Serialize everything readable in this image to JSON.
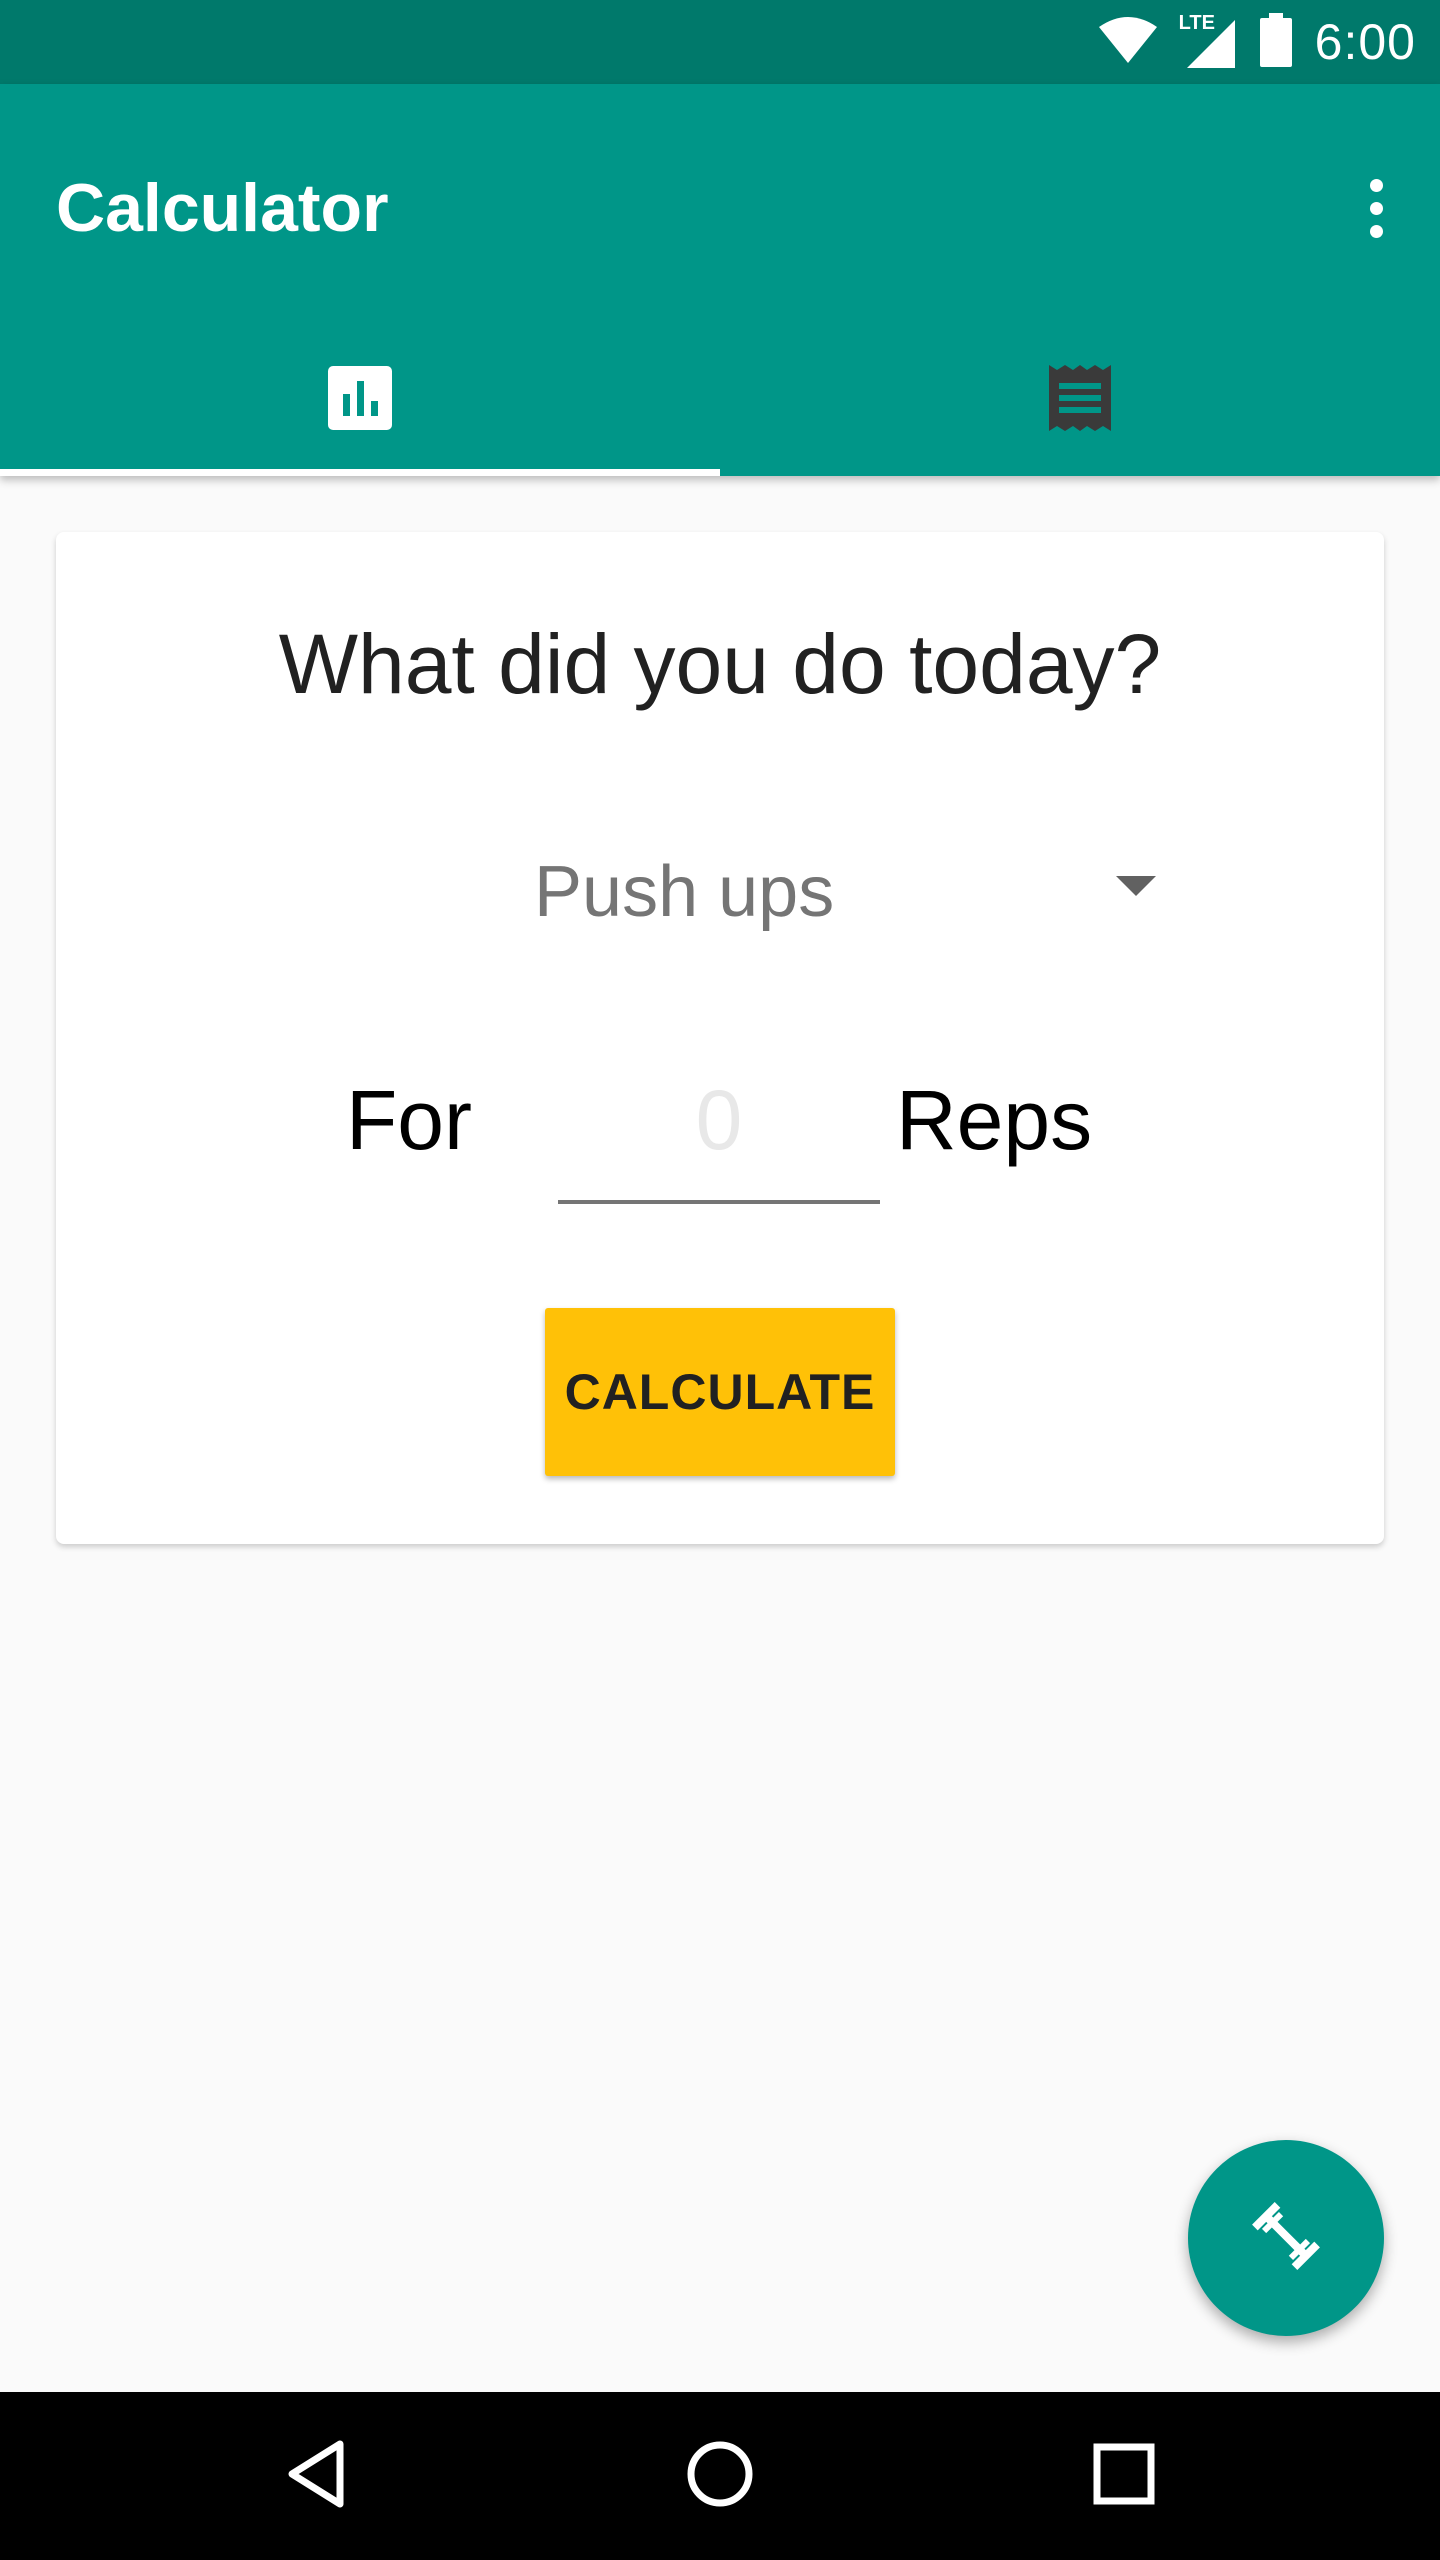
{
  "status_bar": {
    "time": "6:00",
    "network": "LTE",
    "icons": [
      "wifi-icon",
      "cell-signal-icon",
      "battery-icon"
    ]
  },
  "app_bar": {
    "title": "Calculator",
    "overflow_icon": "more-vert-icon"
  },
  "tabs": [
    {
      "icon": "bar-chart-icon",
      "active": true
    },
    {
      "icon": "receipt-list-icon",
      "active": false
    }
  ],
  "card": {
    "question": "What did you do today?",
    "exercise_select": {
      "value": "Push ups"
    },
    "for_label": "For",
    "reps_input": {
      "placeholder": "0"
    },
    "reps_label": "Reps",
    "calculate_button": "CALCULATE"
  },
  "fab": {
    "icon": "fitness-dumbbell-icon"
  },
  "nav_bar": {
    "buttons": [
      "back-icon",
      "home-icon",
      "recents-icon"
    ]
  },
  "colors": {
    "primary": "#009688",
    "primary_dark": "#00796b",
    "accent": "#ffc107",
    "background": "#fafafa"
  }
}
